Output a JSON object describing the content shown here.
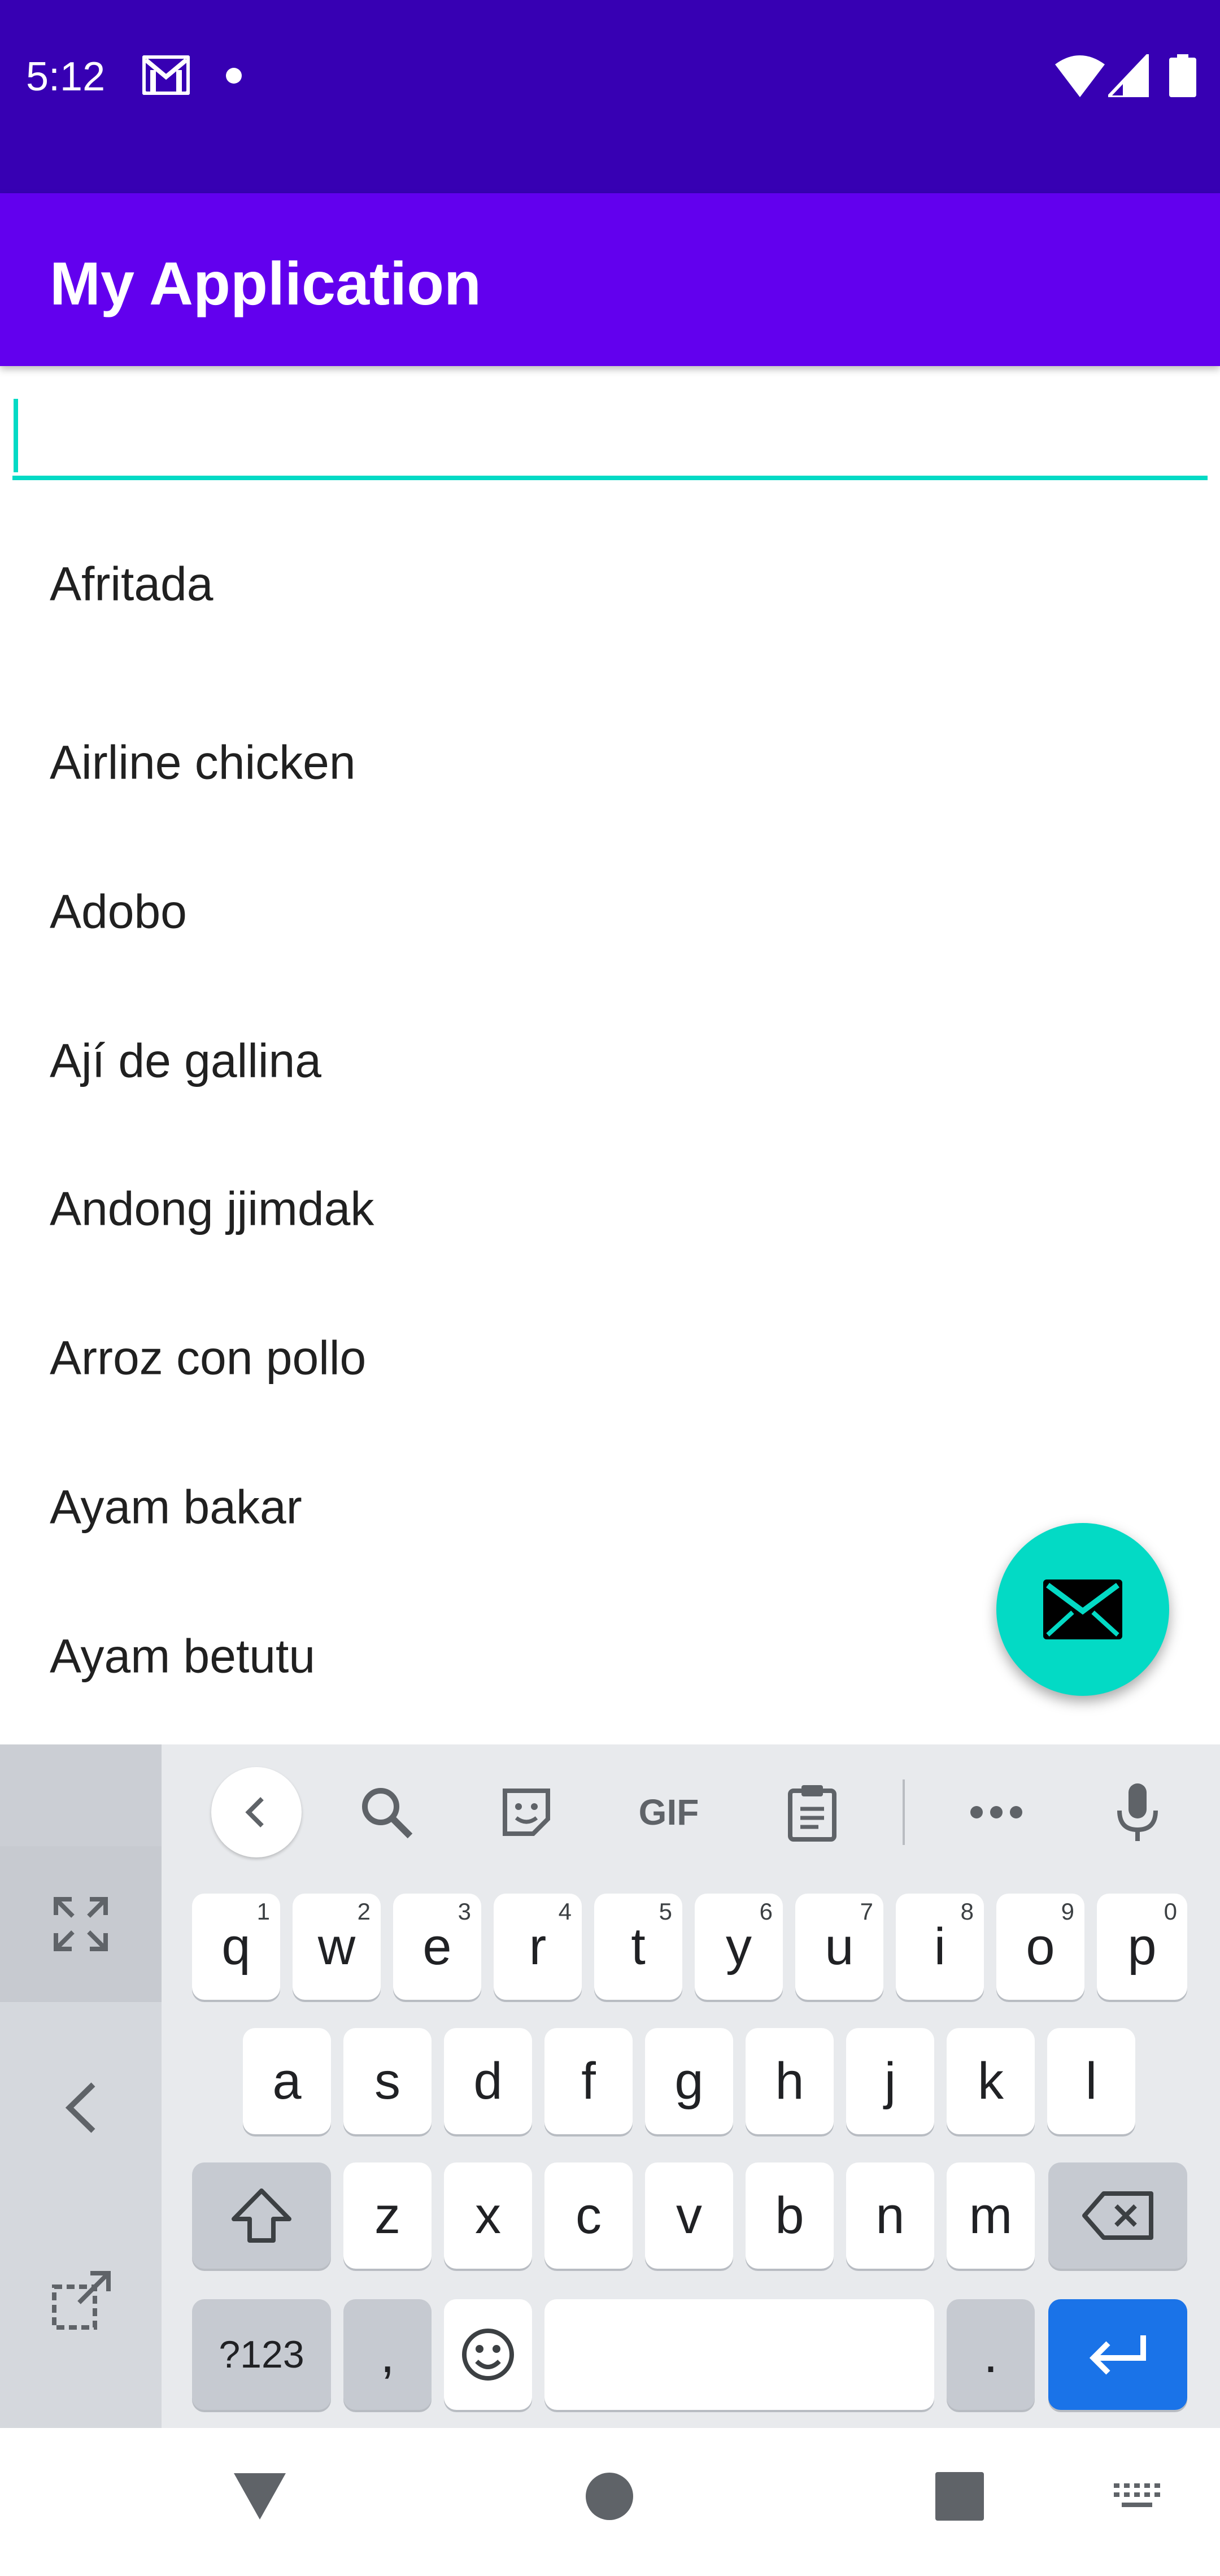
{
  "status_bar": {
    "time": "5:12",
    "icons": [
      "gmail-icon",
      "notification-dot-icon",
      "wifi-icon",
      "signal-icon",
      "battery-icon"
    ],
    "background": "#3700b3"
  },
  "app_bar": {
    "title": "My Application",
    "background": "#6200ee"
  },
  "search": {
    "value": "",
    "placeholder": "",
    "accent": "#03dac5"
  },
  "list": {
    "items": [
      {
        "label": "Afritada"
      },
      {
        "label": "Airline chicken"
      },
      {
        "label": "Adobo"
      },
      {
        "label": "Ají de gallina"
      },
      {
        "label": "Andong jjimdak"
      },
      {
        "label": "Arroz con pollo"
      },
      {
        "label": "Ayam bakar"
      },
      {
        "label": "Ayam betutu"
      }
    ]
  },
  "fab": {
    "icon": "mail-icon",
    "color": "#03dac5"
  },
  "keyboard": {
    "toolbar": [
      "back-icon",
      "search-icon",
      "sticker-icon",
      "gif-icon",
      "clipboard-icon",
      "more-icon",
      "mic-icon"
    ],
    "gif_label": "GIF",
    "side": [
      "expand-icon",
      "back-icon",
      "undock-icon"
    ],
    "row1": [
      {
        "key": "q",
        "hint": "1"
      },
      {
        "key": "w",
        "hint": "2"
      },
      {
        "key": "e",
        "hint": "3"
      },
      {
        "key": "r",
        "hint": "4"
      },
      {
        "key": "t",
        "hint": "5"
      },
      {
        "key": "y",
        "hint": "6"
      },
      {
        "key": "u",
        "hint": "7"
      },
      {
        "key": "i",
        "hint": "8"
      },
      {
        "key": "o",
        "hint": "9"
      },
      {
        "key": "p",
        "hint": "0"
      }
    ],
    "row2": [
      "a",
      "s",
      "d",
      "f",
      "g",
      "h",
      "j",
      "k",
      "l"
    ],
    "row3": [
      "z",
      "x",
      "c",
      "v",
      "b",
      "n",
      "m"
    ],
    "row4": {
      "symbols": "?123",
      "comma": ",",
      "period": "."
    },
    "enter_color": "#1a73e8"
  },
  "nav_bar": {
    "icons": [
      "back-triangle-icon",
      "home-circle-icon",
      "recents-square-icon",
      "keyboard-switch-icon"
    ]
  }
}
